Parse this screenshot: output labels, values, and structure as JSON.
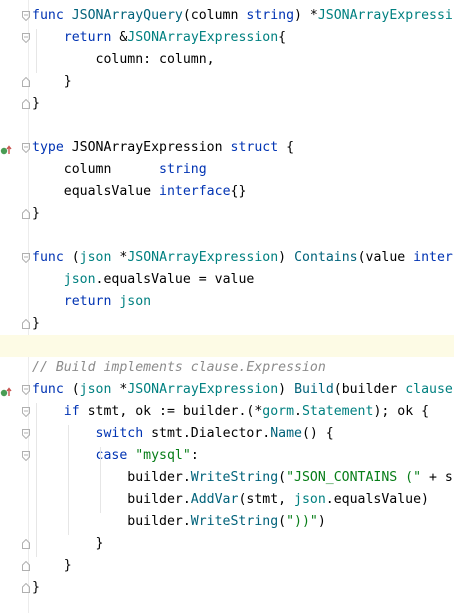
{
  "editor": {
    "lines": [
      {
        "t": [
          [
            "kw",
            "func "
          ],
          [
            "fn",
            "JSONArrayQuery"
          ],
          [
            "plain",
            "(column "
          ],
          [
            "kw",
            "string"
          ],
          [
            "plain",
            ") *"
          ],
          [
            "tname",
            "JSONArrayExpressi"
          ]
        ],
        "fold": "open"
      },
      {
        "t": [
          [
            "plain",
            "    "
          ],
          [
            "kw",
            "return "
          ],
          [
            "plain",
            "&"
          ],
          [
            "tname",
            "JSONArrayExpression"
          ],
          [
            "plain",
            "{"
          ]
        ],
        "fold": "open"
      },
      {
        "t": [
          [
            "plain",
            "        column: column,"
          ]
        ]
      },
      {
        "t": [
          [
            "plain",
            "    }"
          ]
        ],
        "fold": "close"
      },
      {
        "t": [
          [
            "plain",
            "}"
          ]
        ],
        "fold": "close"
      },
      {
        "t": []
      },
      {
        "t": [
          [
            "kw",
            "type "
          ],
          [
            "plain",
            "JSONArrayExpression "
          ],
          [
            "kw",
            "struct "
          ],
          [
            "plain",
            "{"
          ]
        ],
        "fold": "open",
        "marker": "implemented"
      },
      {
        "t": [
          [
            "plain",
            "    column      "
          ],
          [
            "kw",
            "string"
          ]
        ]
      },
      {
        "t": [
          [
            "plain",
            "    equalsValue "
          ],
          [
            "kw",
            "interface"
          ],
          [
            "plain",
            "{}"
          ]
        ]
      },
      {
        "t": [
          [
            "plain",
            "}"
          ]
        ],
        "fold": "close"
      },
      {
        "t": []
      },
      {
        "t": [
          [
            "kw",
            "func "
          ],
          [
            "plain",
            "("
          ],
          [
            "tname",
            "json"
          ],
          [
            "plain",
            " *"
          ],
          [
            "tname",
            "JSONArrayExpression"
          ],
          [
            "plain",
            ") "
          ],
          [
            "fn",
            "Contains"
          ],
          [
            "plain",
            "(value "
          ],
          [
            "kw",
            "inter"
          ]
        ],
        "fold": "open"
      },
      {
        "t": [
          [
            "plain",
            "    "
          ],
          [
            "tname",
            "json"
          ],
          [
            "plain",
            ".equalsValue = value"
          ]
        ]
      },
      {
        "t": [
          [
            "plain",
            "    "
          ],
          [
            "kw",
            "return "
          ],
          [
            "tname",
            "json"
          ]
        ]
      },
      {
        "t": [
          [
            "plain",
            "}"
          ]
        ],
        "fold": "close"
      },
      {
        "t": [],
        "highlight": true
      },
      {
        "t": [
          [
            "cmt",
            "// Build implements clause.Expression"
          ]
        ]
      },
      {
        "t": [
          [
            "kw",
            "func "
          ],
          [
            "plain",
            "("
          ],
          [
            "tname",
            "json"
          ],
          [
            "plain",
            " *"
          ],
          [
            "tname",
            "JSONArrayExpression"
          ],
          [
            "plain",
            ") "
          ],
          [
            "fn",
            "Build"
          ],
          [
            "plain",
            "(builder "
          ],
          [
            "pkg",
            "clause"
          ]
        ],
        "fold": "open",
        "marker": "implemented"
      },
      {
        "t": [
          [
            "plain",
            "    "
          ],
          [
            "kw",
            "if "
          ],
          [
            "plain",
            "stmt, ok := builder.(*"
          ],
          [
            "pkg",
            "gorm"
          ],
          [
            "plain",
            "."
          ],
          [
            "tname",
            "Statement"
          ],
          [
            "plain",
            "); ok {"
          ]
        ],
        "fold": "open"
      },
      {
        "t": [
          [
            "plain",
            "        "
          ],
          [
            "kw",
            "switch "
          ],
          [
            "plain",
            "stmt.Dialector."
          ],
          [
            "fn",
            "Name"
          ],
          [
            "plain",
            "() {"
          ]
        ],
        "fold": "open"
      },
      {
        "t": [
          [
            "plain",
            "        "
          ],
          [
            "kw",
            "case "
          ],
          [
            "str",
            "\"mysql\""
          ],
          [
            "plain",
            ":"
          ]
        ],
        "fold": "open"
      },
      {
        "t": [
          [
            "plain",
            "            builder."
          ],
          [
            "fn",
            "WriteString"
          ],
          [
            "plain",
            "("
          ],
          [
            "str",
            "\"JSON_CONTAINS (\""
          ],
          [
            "plain",
            " + s"
          ]
        ]
      },
      {
        "t": [
          [
            "plain",
            "            builder."
          ],
          [
            "fn",
            "AddVar"
          ],
          [
            "plain",
            "(stmt, "
          ],
          [
            "tname",
            "json"
          ],
          [
            "plain",
            ".equalsValue)"
          ]
        ]
      },
      {
        "t": [
          [
            "plain",
            "            builder."
          ],
          [
            "fn",
            "WriteString"
          ],
          [
            "plain",
            "("
          ],
          [
            "str",
            "\"))\""
          ],
          [
            "plain",
            ")"
          ]
        ]
      },
      {
        "t": [
          [
            "plain",
            "        }"
          ]
        ],
        "fold": "close"
      },
      {
        "t": [
          [
            "plain",
            "    }"
          ]
        ],
        "fold": "close"
      },
      {
        "t": [
          [
            "plain",
            "}"
          ]
        ],
        "fold": "close"
      }
    ],
    "colors": {
      "keyword": "#0033b3",
      "string": "#067d17",
      "function": "#00627a",
      "type": "#008080",
      "comment": "#8c8c8c",
      "highlight_line": "#fdfbe5",
      "marker_green": "#499c54",
      "marker_red": "#c75450"
    },
    "icons": {
      "fold_open": "fold-open-icon",
      "fold_close": "fold-close-icon",
      "implemented": "implemented-marker-icon"
    }
  }
}
